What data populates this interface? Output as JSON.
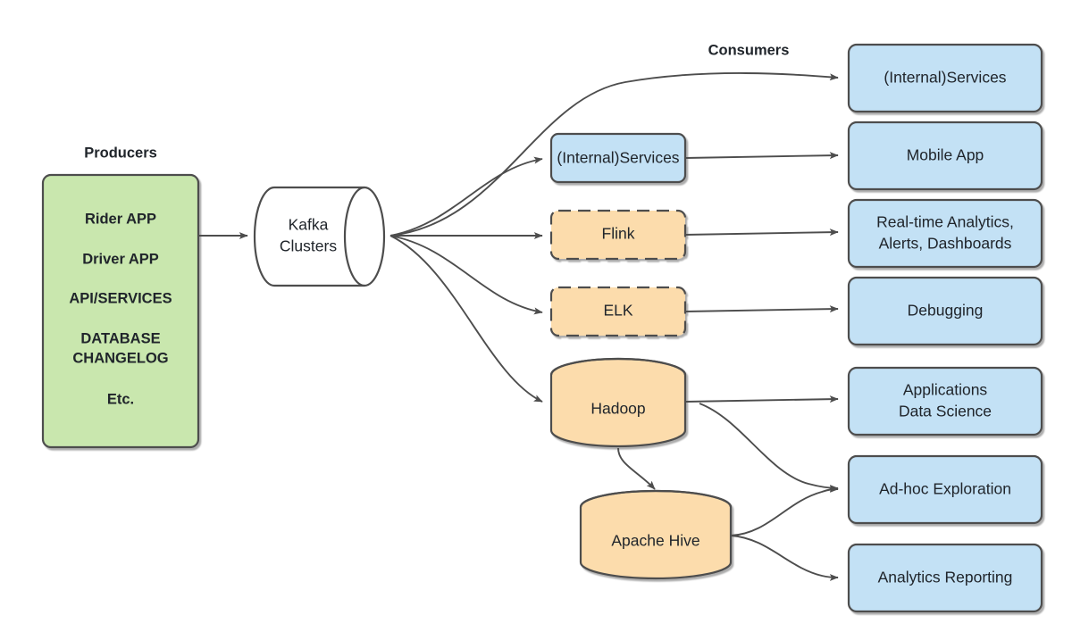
{
  "diagram": {
    "title_producers": "Producers",
    "title_consumers": "Consumers",
    "colors": {
      "green_fill": "#c9e7ae",
      "blue_fill": "#c3e1f5",
      "orange_fill": "#fcdcac",
      "white_fill": "#ffffff",
      "stroke": "#4d4d4d",
      "text": "#20252b",
      "background": "#ffffff"
    },
    "producers": {
      "label": "Producers",
      "items": [
        "Rider APP",
        "Driver APP",
        "API/SERVICES",
        "DATABASE",
        "CHANGELOG",
        "Etc."
      ]
    },
    "broker": {
      "line1": "Kafka",
      "line2": "Clusters",
      "shape": "cylinder-horizontal",
      "fill": "#ffffff"
    },
    "middle_nodes": [
      {
        "label": "(Internal)Services",
        "shape": "rounded-rect",
        "fill": "#c3e1f5",
        "border": "solid"
      },
      {
        "label": "Flink",
        "shape": "rounded-rect",
        "fill": "#fcdcac",
        "border": "dashed"
      },
      {
        "label": "ELK",
        "shape": "rounded-rect",
        "fill": "#fcdcac",
        "border": "dashed"
      },
      {
        "label": "Hadoop",
        "shape": "cylinder-vertical",
        "fill": "#fcdcac",
        "border": "solid"
      },
      {
        "label": "Apache Hive",
        "shape": "cylinder-vertical",
        "fill": "#fcdcac",
        "border": "solid"
      }
    ],
    "consumer_nodes": [
      {
        "line1": "(Internal)Services",
        "line2": "",
        "shape": "rounded-rect",
        "fill": "#c3e1f5"
      },
      {
        "line1": "Mobile App",
        "line2": "",
        "shape": "rounded-rect",
        "fill": "#c3e1f5"
      },
      {
        "line1": "Real-time Analytics,",
        "line2": "Alerts, Dashboards",
        "shape": "rounded-rect",
        "fill": "#c3e1f5"
      },
      {
        "line1": "Debugging",
        "line2": "",
        "shape": "rounded-rect",
        "fill": "#c3e1f5"
      },
      {
        "line1": "Applications",
        "line2": "Data Science",
        "shape": "rounded-rect",
        "fill": "#c3e1f5"
      },
      {
        "line1": "Ad-hoc Exploration",
        "line2": "",
        "shape": "rounded-rect",
        "fill": "#c3e1f5"
      },
      {
        "line1": "Analytics Reporting",
        "line2": "",
        "shape": "rounded-rect",
        "fill": "#c3e1f5"
      }
    ],
    "edges": [
      {
        "from": "producers",
        "to": "kafka-clusters",
        "style": "straight-arrow"
      },
      {
        "from": "kafka-clusters",
        "to": "consumer-internal-services",
        "style": "curved-arrow"
      },
      {
        "from": "kafka-clusters",
        "to": "middle-internal-services",
        "style": "curved-arrow"
      },
      {
        "from": "kafka-clusters",
        "to": "flink",
        "style": "straight-arrow"
      },
      {
        "from": "kafka-clusters",
        "to": "elk",
        "style": "curved-arrow"
      },
      {
        "from": "kafka-clusters",
        "to": "hadoop",
        "style": "curved-arrow"
      },
      {
        "from": "middle-internal-services",
        "to": "mobile-app",
        "style": "straight-arrow"
      },
      {
        "from": "flink",
        "to": "real-time-analytics",
        "style": "straight-arrow"
      },
      {
        "from": "elk",
        "to": "debugging",
        "style": "straight-arrow"
      },
      {
        "from": "hadoop",
        "to": "applications-data-science",
        "style": "straight-arrow"
      },
      {
        "from": "hadoop",
        "to": "ad-hoc-exploration",
        "style": "curved-arrow"
      },
      {
        "from": "hadoop",
        "to": "apache-hive",
        "style": "curved-arrow"
      },
      {
        "from": "apache-hive",
        "to": "ad-hoc-exploration",
        "style": "curved-arrow"
      },
      {
        "from": "apache-hive",
        "to": "analytics-reporting",
        "style": "curved-arrow"
      }
    ]
  }
}
